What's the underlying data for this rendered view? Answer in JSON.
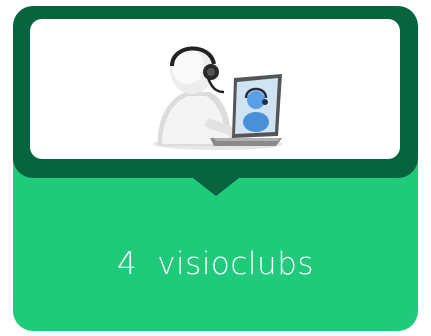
{
  "card": {
    "count": "4",
    "label": "visioclubs",
    "colors": {
      "card_background": "#1fca7b",
      "header_band": "#08643f",
      "panel": "#ffffff",
      "text": "#ffffff"
    }
  },
  "illustration": {
    "icon": "video-call-icon"
  }
}
